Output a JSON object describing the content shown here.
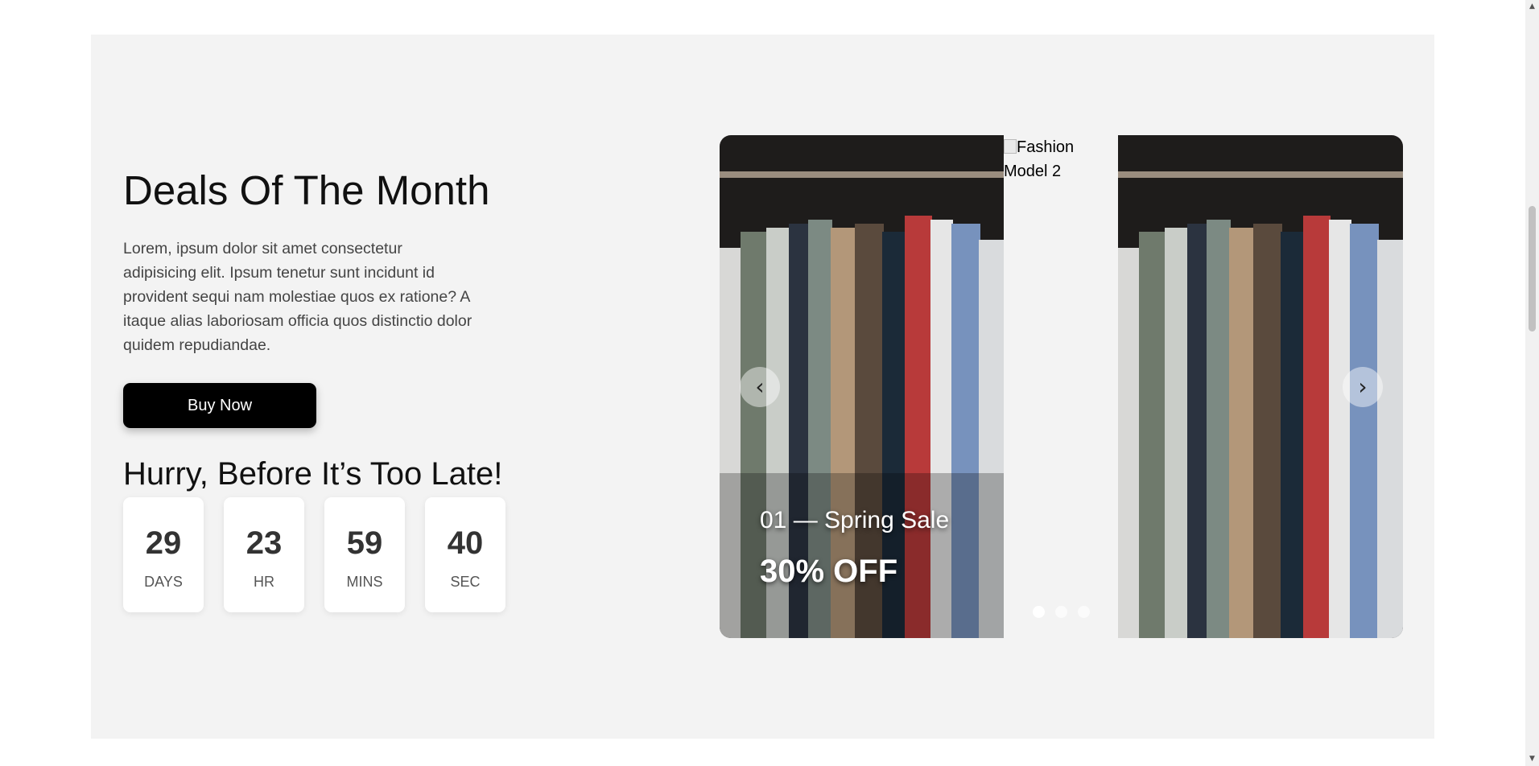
{
  "deal": {
    "title": "Deals Of The Month",
    "description": "Lorem, ipsum dolor sit amet consectetur adipisicing elit. Ipsum tenetur sunt incidunt id provident sequi nam molestiae quos ex ratione? A itaque alias laboriosam officia quos distinctio dolor quidem repudiandae.",
    "buy_label": "Buy Now",
    "hurry": "Hurry, Before It’s Too Late!",
    "countdown": [
      {
        "value": "29",
        "label": "DAYS"
      },
      {
        "value": "23",
        "label": "HR"
      },
      {
        "value": "59",
        "label": "MINS"
      },
      {
        "value": "40",
        "label": "SEC"
      }
    ]
  },
  "slider": {
    "broken_alt": "Fashion Model 2",
    "caption_title": "01 — Spring Sale",
    "caption_offer": "30% OFF",
    "prev_icon": "‹",
    "next_icon": "›",
    "dots": 3,
    "active_dot": 1
  },
  "colors": {
    "section_bg": "#f3f3f3",
    "button_bg": "#000000",
    "button_text": "#ffffff"
  }
}
